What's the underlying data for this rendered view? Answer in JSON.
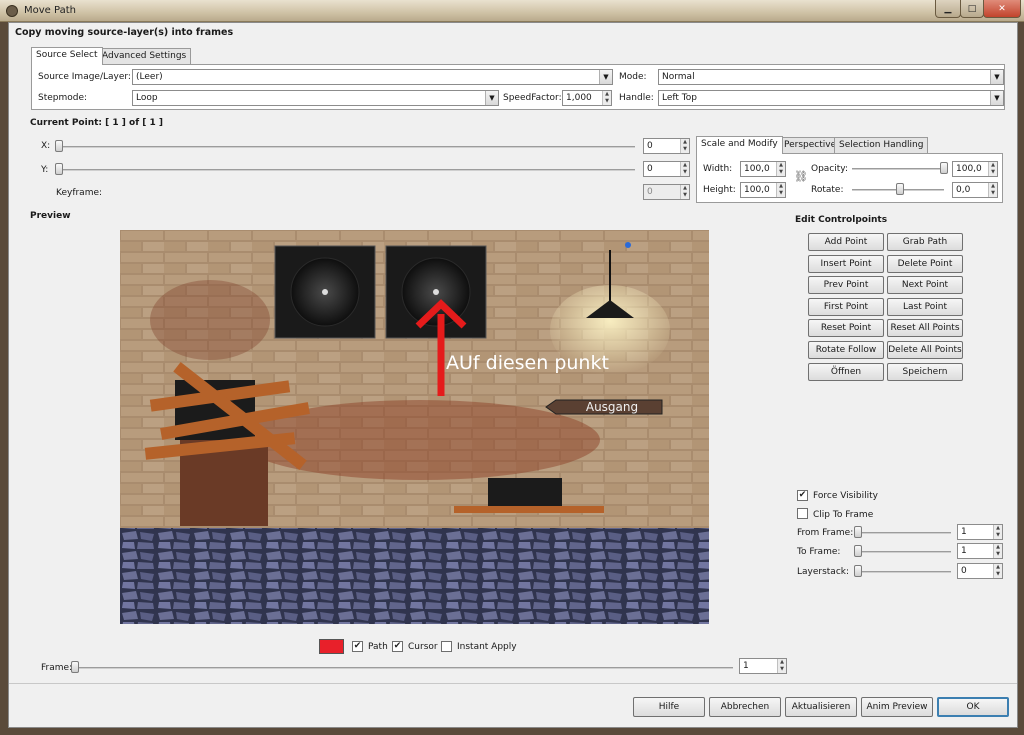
{
  "window": {
    "title": "Move Path"
  },
  "dialog": {
    "heading": "Copy moving source-layer(s) into frames"
  },
  "tabs": {
    "source_select": "Source Select",
    "advanced": "Advanced Settings"
  },
  "source": {
    "image_layer_label": "Source Image/Layer:",
    "image_layer_value": "(Leer)",
    "mode_label": "Mode:",
    "mode_value": "Normal",
    "stepmode_label": "Stepmode:",
    "stepmode_value": "Loop",
    "speed_label": "SpeedFactor:",
    "speed_value": "1,000",
    "handle_label": "Handle:",
    "handle_value": "Left  Top"
  },
  "point": {
    "current_label": "Current Point: [  1 ] of [   1 ]",
    "x_label": "X:",
    "x_value": "0",
    "y_label": "Y:",
    "y_value": "0",
    "keyframe_label": "Keyframe:",
    "keyframe_value": "0"
  },
  "transform_tabs": {
    "scale": "Scale and Modify",
    "perspective": "Perspective",
    "selection": "Selection Handling"
  },
  "transform": {
    "width_label": "Width:",
    "width_value": "100,0",
    "height_label": "Height:",
    "height_value": "100,0",
    "opacity_label": "Opacity:",
    "opacity_value": "100,0",
    "rotate_label": "Rotate:",
    "rotate_value": "0,0"
  },
  "preview": {
    "label": "Preview",
    "annotation": "AUf diesen punkt",
    "sign": "Ausgang"
  },
  "controlpoints": {
    "title": "Edit Controlpoints",
    "buttons": [
      "Add Point",
      "Grab Path",
      "Insert Point",
      "Delete Point",
      "Prev Point",
      "Next Point",
      "First Point",
      "Last Point",
      "Reset Point",
      "Reset All Points",
      "Rotate Follow",
      "Delete All Points",
      "Öffnen",
      "Speichern"
    ]
  },
  "options": {
    "force_visibility": "Force Visibility",
    "clip_to_frame": "Clip To Frame",
    "from_frame_label": "From Frame:",
    "from_frame_value": "1",
    "to_frame_label": "To Frame:",
    "to_frame_value": "1",
    "layerstack_label": "Layerstack:",
    "layerstack_value": "0"
  },
  "path_opts": {
    "path": "Path",
    "cursor": "Cursor",
    "instant_apply": "Instant Apply",
    "path_color": "#e8202a"
  },
  "frame": {
    "label": "Frame:",
    "value": "1"
  },
  "footer": {
    "help": "Hilfe",
    "cancel": "Abbrechen",
    "refresh": "Aktualisieren",
    "anim_preview": "Anim Preview",
    "ok": "OK"
  }
}
